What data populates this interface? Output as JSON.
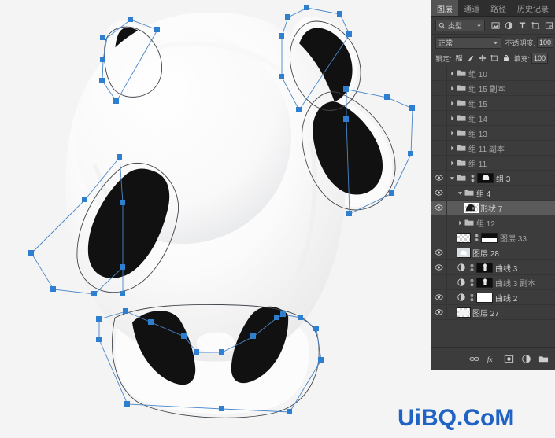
{
  "app": {
    "name": "Adobe Photoshop",
    "canvas_background": "#f4f4f4",
    "panel_background": "#3c3c3c",
    "selection_accent": "#2f7fd1",
    "watermark": "UiBQ.CoM",
    "watermark_color": "#1f63c4"
  },
  "panel": {
    "tabs": [
      {
        "label": "图层",
        "active": true,
        "name": "tab-layers"
      },
      {
        "label": "通道",
        "active": false,
        "name": "tab-channels"
      },
      {
        "label": "路径",
        "active": false,
        "name": "tab-paths"
      },
      {
        "label": "历史记录",
        "active": false,
        "name": "tab-history"
      }
    ],
    "filter": {
      "kind_label": "类型",
      "icons": [
        "pixel-filter-icon",
        "adjustment-filter-icon",
        "type-filter-icon",
        "shape-filter-icon",
        "smartobject-filter-icon"
      ]
    },
    "blend": {
      "mode": "正常",
      "opacity_label": "不透明度:",
      "opacity_value": "100"
    },
    "lock": {
      "label": "锁定:",
      "icons": [
        "lock-transparent-icon",
        "lock-image-icon",
        "lock-position-icon",
        "lock-artboard-icon",
        "lock-all-icon"
      ],
      "fill_label": "填充:",
      "fill_value": "100"
    },
    "bottom_icons": [
      {
        "name": "link-layers-icon",
        "glyph": "link"
      },
      {
        "name": "layer-style-fx-icon",
        "glyph": "fx"
      },
      {
        "name": "add-layer-mask-icon",
        "glyph": "mask"
      },
      {
        "name": "new-adjustment-layer-icon",
        "glyph": "adjust"
      },
      {
        "name": "new-group-icon",
        "glyph": "folder"
      }
    ],
    "layers": [
      {
        "name": "组 10",
        "type": "group",
        "visible": false,
        "expanded": false,
        "indent": 1,
        "selected": false
      },
      {
        "name": "组 15 副本",
        "type": "group",
        "visible": false,
        "expanded": false,
        "indent": 1,
        "selected": false
      },
      {
        "name": "组 15",
        "type": "group",
        "visible": false,
        "expanded": false,
        "indent": 1,
        "selected": false
      },
      {
        "name": "组 14",
        "type": "group",
        "visible": false,
        "expanded": false,
        "indent": 1,
        "selected": false
      },
      {
        "name": "组 13",
        "type": "group",
        "visible": false,
        "expanded": false,
        "indent": 1,
        "selected": false
      },
      {
        "name": "组 11 副本",
        "type": "group",
        "visible": false,
        "expanded": false,
        "indent": 1,
        "selected": false
      },
      {
        "name": "组 11",
        "type": "group",
        "visible": false,
        "expanded": false,
        "indent": 1,
        "selected": false
      },
      {
        "name": "组 3",
        "type": "group-masked",
        "visible": true,
        "expanded": true,
        "indent": 1,
        "selected": false,
        "mask": "dark"
      },
      {
        "name": "组 4",
        "type": "group",
        "visible": true,
        "expanded": true,
        "indent": 2,
        "selected": false
      },
      {
        "name": "形状 7",
        "type": "shape",
        "visible": true,
        "expanded": false,
        "indent": 3,
        "selected": true
      },
      {
        "name": "组 12",
        "type": "group",
        "visible": false,
        "expanded": false,
        "indent": 2,
        "selected": false
      },
      {
        "name": "图层 33",
        "type": "pixel-masked",
        "visible": false,
        "expanded": false,
        "indent": 2,
        "selected": false,
        "mask": "split"
      },
      {
        "name": "图层 28",
        "type": "pixel",
        "visible": true,
        "expanded": false,
        "indent": 2,
        "selected": false
      },
      {
        "name": "曲线 3",
        "type": "adjustment",
        "visible": true,
        "expanded": false,
        "indent": 2,
        "selected": false,
        "mask": "dark-curve"
      },
      {
        "name": "曲线 3 副本",
        "type": "adjustment",
        "visible": false,
        "expanded": false,
        "indent": 2,
        "selected": false,
        "mask": "dark-curve"
      },
      {
        "name": "曲线 2",
        "type": "adjustment",
        "visible": true,
        "expanded": false,
        "indent": 2,
        "selected": false,
        "mask": "white"
      },
      {
        "name": "图层 27",
        "type": "pixel",
        "visible": true,
        "expanded": false,
        "indent": 2,
        "selected": false
      }
    ]
  },
  "artwork": {
    "subject": "panda illustration with vector path selection",
    "body_color": "#fdfdfd",
    "marking_color": "#111111",
    "path_stroke": "#2f7fd1",
    "anchor_color": "#2f7fd1"
  }
}
